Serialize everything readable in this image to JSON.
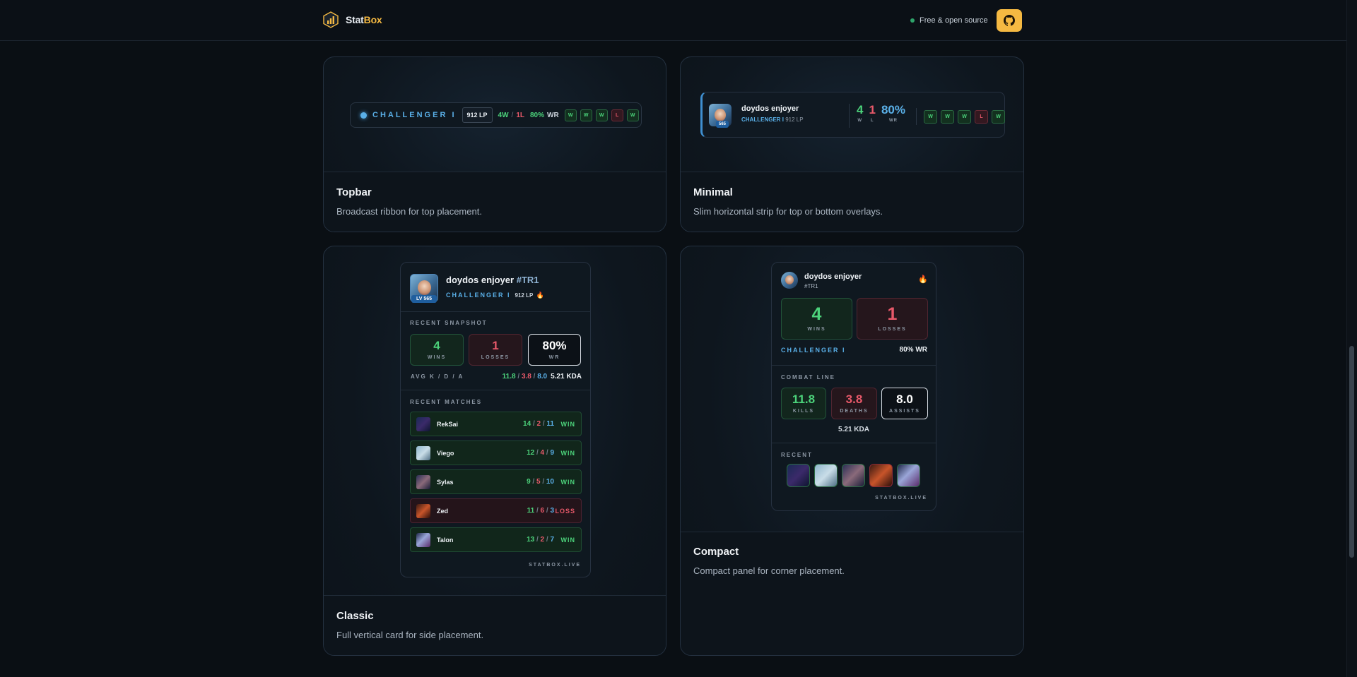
{
  "header": {
    "logo_a": "Stat",
    "logo_b": "Box",
    "oss": "Free & open source",
    "github_icon": "github-icon"
  },
  "player": {
    "name": "doydos enjoyer",
    "tag": "#TR1",
    "rank": "CHALLENGER I",
    "lp": "912 LP",
    "level": "565",
    "level_label": "LV 565"
  },
  "topbar": {
    "wins": "4W",
    "losses": "1L",
    "sep": "/",
    "wr_value": "80%",
    "wr_label": "WR",
    "form": [
      "W",
      "W",
      "W",
      "L",
      "W"
    ],
    "title": "Topbar",
    "desc": "Broadcast ribbon for top placement."
  },
  "minimal": {
    "w_value": "4",
    "w_label": "W",
    "l_value": "1",
    "l_label": "L",
    "wr_value": "80%",
    "wr_label": "WR",
    "form": [
      "W",
      "W",
      "W",
      "L",
      "W"
    ],
    "title": "Minimal",
    "desc": "Slim horizontal strip for top or bottom overlays."
  },
  "classic": {
    "snapshot_label": "RECENT SNAPSHOT",
    "wins_value": "4",
    "wins_label": "WINS",
    "losses_value": "1",
    "losses_label": "LOSSES",
    "wr_value": "80%",
    "wr_label": "WR",
    "avg_label": "AVG K / D / A",
    "avg_k": "11.8",
    "avg_d": "3.8",
    "avg_a": "8.0",
    "kda": "5.21 KDA",
    "matches_label": "RECENT MATCHES",
    "matches": [
      {
        "champion": "RekSai",
        "k": "14",
        "d": "2",
        "a": "11",
        "result": "WIN"
      },
      {
        "champion": "Viego",
        "k": "12",
        "d": "4",
        "a": "9",
        "result": "WIN"
      },
      {
        "champion": "Sylas",
        "k": "9",
        "d": "5",
        "a": "10",
        "result": "WIN"
      },
      {
        "champion": "Zed",
        "k": "11",
        "d": "6",
        "a": "3",
        "result": "LOSS"
      },
      {
        "champion": "Talon",
        "k": "13",
        "d": "2",
        "a": "7",
        "result": "WIN"
      }
    ],
    "brand": "STATBOX.LIVE",
    "title": "Classic",
    "desc": "Full vertical card for side placement."
  },
  "compact": {
    "wins_value": "4",
    "wins_label": "WINS",
    "losses_value": "1",
    "losses_label": "LOSSES",
    "rank": "CHALLENGER I",
    "wr": "80% WR",
    "combat_label": "COMBAT LINE",
    "kills_value": "11.8",
    "kills_label": "KILLS",
    "deaths_value": "3.8",
    "deaths_label": "DEATHS",
    "assists_value": "8.0",
    "assists_label": "ASSISTS",
    "kda": "5.21 KDA",
    "recent_label": "RECENT",
    "brand": "STATBOX.LIVE",
    "title": "Compact",
    "desc": "Compact panel for corner placement."
  },
  "colors": {
    "accent": "#f5b942",
    "win": "#4cd37b",
    "loss": "#e8596a",
    "rank": "#5ab0e8"
  }
}
